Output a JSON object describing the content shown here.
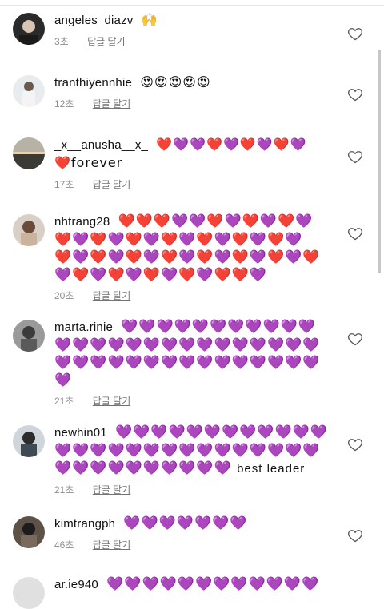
{
  "comments": [
    {
      "username": "angeles_diazv",
      "text": "🙌",
      "time": "3초",
      "reply": "답글 달기"
    },
    {
      "username": "tranthiyennhie",
      "text": "😍😍😍😍😍",
      "time": "12초",
      "reply": "답글 달기"
    },
    {
      "username": "_x__anusha__x_",
      "text": "❤️💜💜❤️💜❤️💜❤️💜",
      "text2": "❤️forever",
      "time": "17초",
      "reply": "답글 달기"
    },
    {
      "username": "nhtrang28",
      "text": "❤️❤️❤️💜💜❤️💜❤️💜❤️💜",
      "line2": "❤️💜❤️💜❤️💜❤️💜❤️💜❤️💜❤️💜",
      "line3": "❤️💜❤️💜❤️💜❤️💜❤️💜❤️💜❤️💜❤️",
      "line4": "💜❤️💜❤️💜❤️💜❤️💜❤️❤️💜",
      "time": "20초",
      "reply": "답글 달기"
    },
    {
      "username": "marta.rinie",
      "text": "💜💜💜💜💜💜💜💜💜💜💜",
      "line2": "💜💜💜💜💜💜💜💜💜💜💜💜💜💜💜",
      "line3": "💜💜💜💜💜💜💜💜💜💜💜💜💜💜💜",
      "line4": "💜",
      "time": "21초",
      "reply": "답글 달기"
    },
    {
      "username": "newhin01",
      "text": "💜💜💜💜💜💜💜💜💜💜💜💜",
      "line2": "💜💜💜💜💜💜💜💜💜💜💜💜💜💜💜",
      "line3": "💜💜💜💜💜💜💜💜💜💜",
      "suffix": "best leader",
      "time": "21초",
      "reply": "답글 달기"
    },
    {
      "username": "kimtrangph",
      "text": "💜💜💜💜💜💜💜",
      "time": "46초",
      "reply": "답글 달기"
    },
    {
      "username": "ar.ie940",
      "text": "💜💜💜💜💜💜💜💜💜💜💜💜"
    }
  ],
  "icons": {
    "like": "heart-outline-icon"
  },
  "colors": {
    "meta": "#8e8e8e",
    "purple_heart": "#a36bf0",
    "red_heart": "#e23a3a"
  }
}
